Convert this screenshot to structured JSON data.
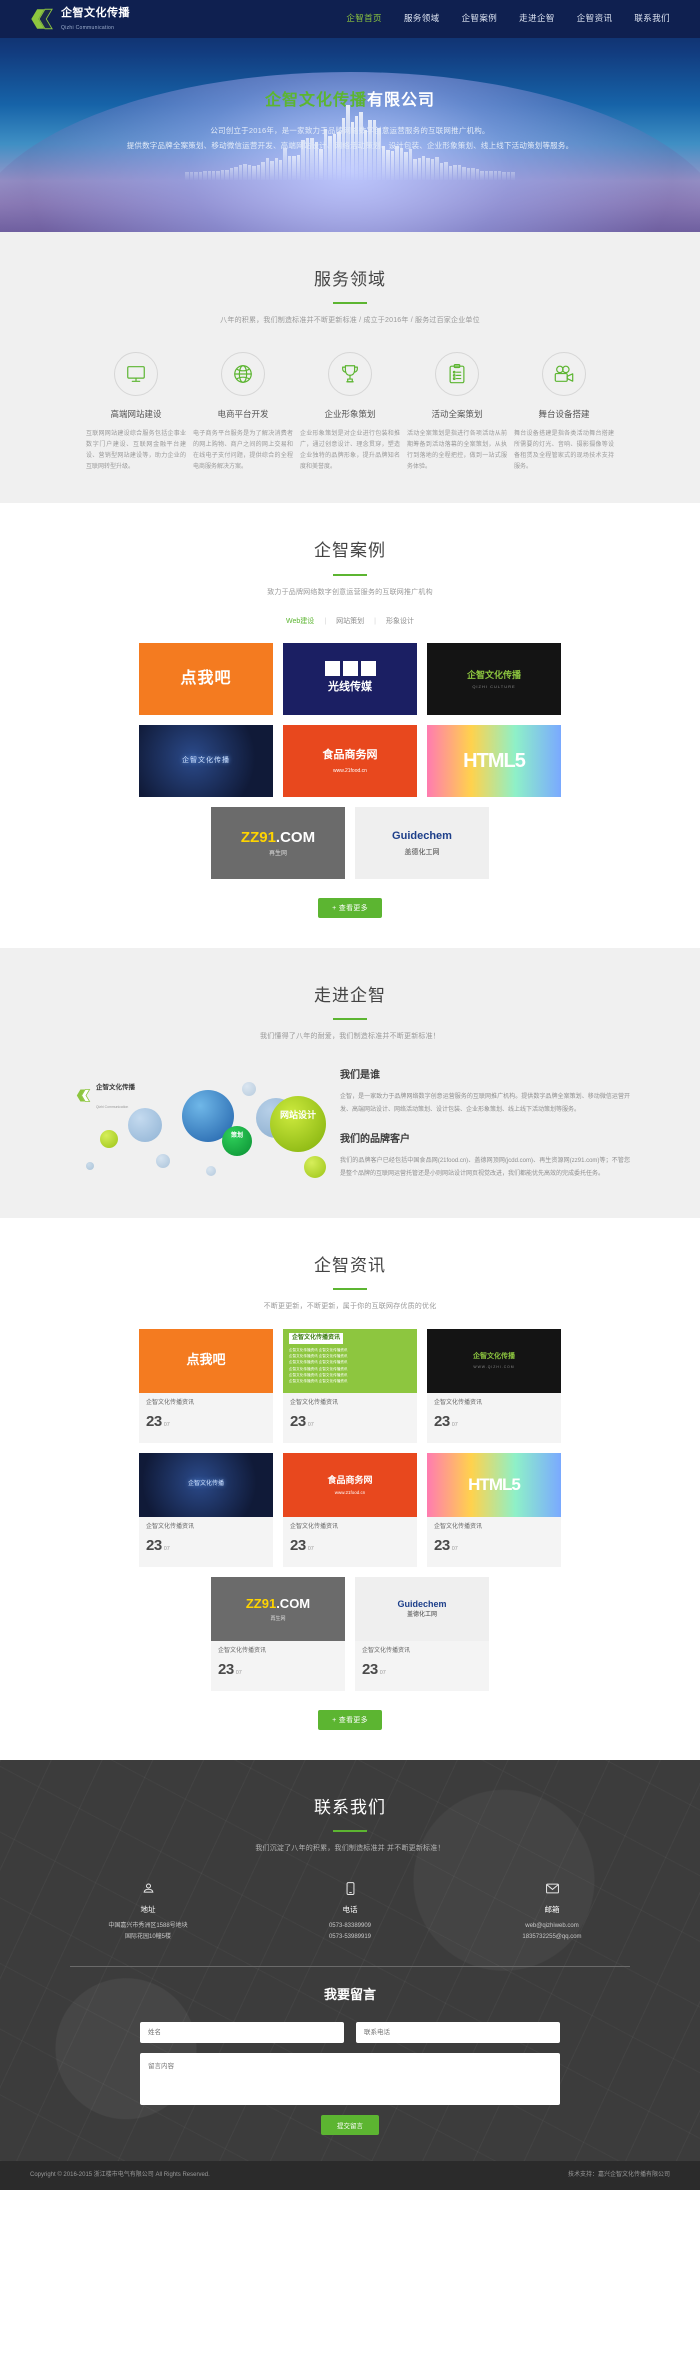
{
  "header": {
    "logo_cn": "企智文化传播",
    "logo_en": "Qizhi Communication",
    "nav": [
      {
        "label": "企智首页",
        "active": true
      },
      {
        "label": "服务领域",
        "active": false
      },
      {
        "label": "企智案例",
        "active": false
      },
      {
        "label": "走进企智",
        "active": false
      },
      {
        "label": "企智资讯",
        "active": false
      },
      {
        "label": "联系我们",
        "active": false
      }
    ]
  },
  "hero": {
    "title_green": "企智文化传播",
    "title_white": "有限公司",
    "sub_line1": "公司创立于2016年，是一家致力于品牌网络数字创意运营服务的互联网推广机构。",
    "sub_line2": "提供数字品牌全案策划、移动微信运营开发、高端网站设计、网络活动策划、设计包装、企业形象策划、线上线下活动策划等服务。"
  },
  "services": {
    "title": "服务领域",
    "desc": "八年的积累，我们制造标准并不断更新标准 / 成立于2016年 / 服务过百家企业单位",
    "items": [
      {
        "icon": "monitor-icon",
        "name": "高端网站建设",
        "text": "互联网网站建设综合服务包括企事业数字门户建设、互联网金融平台建设、营销型网站建设等，助力企业的互联网转型升级。"
      },
      {
        "icon": "globe-icon",
        "name": "电商平台开发",
        "text": "电子商务平台服务是为了解决消费者的网上购物、商户之间的网上交易和在线电子支付问题，提供综合的全程电商服务解决方案。"
      },
      {
        "icon": "trophy-icon",
        "name": "企业形象策划",
        "text": "企业形象策划是对企业进行包装和推广，通过创意设计、理念贯穿，塑造企业独特的品牌形象，提升品牌知名度和美誉度。"
      },
      {
        "icon": "clipboard-icon",
        "name": "活动全案策划",
        "text": "活动全案策划是指进行各项活动从前期筹备到活动落幕的全案策划，从执行到落地的全程把控，做到一站式服务体验。"
      },
      {
        "icon": "camera-icon",
        "name": "舞台设备搭建",
        "text": "舞台设备搭建是指各类活动舞台搭建所需要的灯光、音响、摄影摄像等设备租赁及全程管家式的现场技术支持服务。"
      }
    ]
  },
  "cases": {
    "title": "企智案例",
    "desc": "致力于品牌网络数字创意运营服务的互联网推广机构",
    "filters": [
      {
        "label": "Web建设",
        "active": true
      },
      {
        "label": "网站策划",
        "active": false
      },
      {
        "label": "形象设计",
        "active": false
      }
    ],
    "items": [
      {
        "name": "点我吧",
        "sub": ""
      },
      {
        "name": "光线传媒",
        "sub": ""
      },
      {
        "name": "企智文化传播",
        "sub": "QIZHI CULTURE"
      },
      {
        "name": "企智文化传播",
        "sub": ""
      },
      {
        "name": "食品商务网",
        "sub": "www.21food.cn"
      },
      {
        "name": "HTML5",
        "sub": ""
      },
      {
        "name": "ZZ91.COM",
        "sub": "再生网"
      },
      {
        "name": "盖德化工网",
        "sub": "Guidechem"
      }
    ],
    "more_label": "+ 查看更多"
  },
  "about": {
    "title": "走进企智",
    "desc": "我们懂得了八年的耐爱，我们制造标准并不断更新标准！",
    "logo_cn": "企智文化传播",
    "logo_en": "Qizhi Communication",
    "heading1": "我们是谁",
    "para1": "企智，是一家致力于品牌网络数字创意运营服务的互联网推广机构。提供数字品牌全案策划、移动微信运营开发、高端网站设计、网络活动策划、设计包装、企业形象策划、线上线下活动策划等服务。",
    "heading2": "我们的品牌客户",
    "para2": "我们的品牌客户已经包括中国食品网(21food.cn)、盖德网顶网(jcdd.com)、再生资源网(zz91.com)等；不管您是整个品牌的互联网运营托管还是小则网站设计网页视觉改进，我们都能优先高效的完成委托任务。",
    "bubble_text1": "网站设计",
    "bubble_text2": "策划"
  },
  "news": {
    "title": "企智资讯",
    "desc": "不断更更新，不断更新，属于你的互联网存优质的优化",
    "items": [
      {
        "title": "企智文化传播资讯",
        "day": "23",
        "month": "07"
      },
      {
        "title": "企智文化传播资讯",
        "day": "23",
        "month": "07"
      },
      {
        "title": "企智文化传播资讯",
        "day": "23",
        "month": "07"
      },
      {
        "title": "企智文化传播资讯",
        "day": "23",
        "month": "07"
      },
      {
        "title": "企智文化传播资讯",
        "day": "23",
        "month": "07"
      },
      {
        "title": "企智文化传播资讯",
        "day": "23",
        "month": "07"
      },
      {
        "title": "企智文化传播资讯",
        "day": "23",
        "month": "07"
      },
      {
        "title": "企智文化传播资讯",
        "day": "23",
        "month": "07"
      }
    ],
    "feature_card_title": "企智文化传播资讯",
    "more_label": "+ 查看更多"
  },
  "contact": {
    "title": "联系我们",
    "desc": "我们沉淀了八年的积累，我们制造标准并 并不断更新标准！",
    "items": [
      {
        "icon": "location-icon",
        "label": "地址",
        "value": "中国嘉兴市秀洲区1588号地块\n国际花园10幢5楼"
      },
      {
        "icon": "phone-icon",
        "label": "电话",
        "value": "0573-83389909\n0573-53989919"
      },
      {
        "icon": "mail-icon",
        "label": "邮箱",
        "value": "web@qizhiweb.com\n1835732255@qq.com"
      }
    ],
    "form_title": "我要留言",
    "name_placeholder": "姓名",
    "phone_placeholder": "联系电话",
    "message_placeholder": "留言内容",
    "submit_label": "提交留言"
  },
  "footer": {
    "copyright": "Copyright © 2016-2015 浙江楼市电气有限公司 All Rights Reserved.",
    "credit": "技术支持：嘉兴企智文化传播有限公司"
  },
  "colors": {
    "brand_green": "#5cb531",
    "header_navy": "#0f2050",
    "dark_grey": "#3c3c3c"
  }
}
